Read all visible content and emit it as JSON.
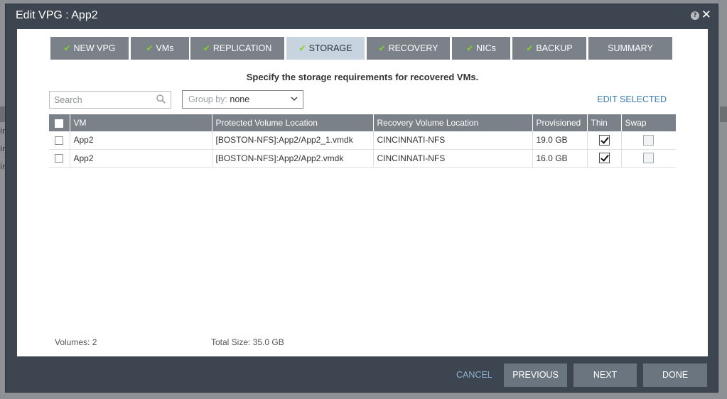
{
  "window": {
    "title": "Edit VPG : App2"
  },
  "tabs": [
    {
      "label": "NEW VPG",
      "checked": true
    },
    {
      "label": "VMs",
      "checked": true
    },
    {
      "label": "REPLICATION",
      "checked": true
    },
    {
      "label": "STORAGE",
      "checked": true,
      "active": true
    },
    {
      "label": "RECOVERY",
      "checked": true
    },
    {
      "label": "NICs",
      "checked": true
    },
    {
      "label": "BACKUP",
      "checked": true
    },
    {
      "label": "SUMMARY",
      "checked": false
    }
  ],
  "subtitle": "Specify the storage requirements for recovered VMs.",
  "search": {
    "placeholder": "Search"
  },
  "groupby": {
    "label": "Group by:",
    "value": "none"
  },
  "edit_selected": "EDIT SELECTED",
  "table": {
    "headers": [
      "VM",
      "Protected Volume Location",
      "Recovery Volume Location",
      "Provisioned",
      "Thin",
      "Swap"
    ],
    "rows": [
      {
        "vm": "App2",
        "protected": "[BOSTON-NFS]:App2/App2_1.vmdk",
        "recovery": "CINCINNATI-NFS",
        "provisioned": "19.0 GB",
        "thin": true,
        "swap": false
      },
      {
        "vm": "App2",
        "protected": "[BOSTON-NFS]:App2/App2.vmdk",
        "recovery": "CINCINNATI-NFS",
        "provisioned": "16.0 GB",
        "thin": true,
        "swap": false
      }
    ]
  },
  "footer": {
    "volumes": "Volumes: 2",
    "total_size": "Total Size: 35.0 GB"
  },
  "buttons": {
    "cancel": "CANCEL",
    "previous": "PREVIOUS",
    "next": "NEXT",
    "done": "DONE"
  },
  "background_fragments": [
    "ir",
    "ir",
    "ir"
  ]
}
